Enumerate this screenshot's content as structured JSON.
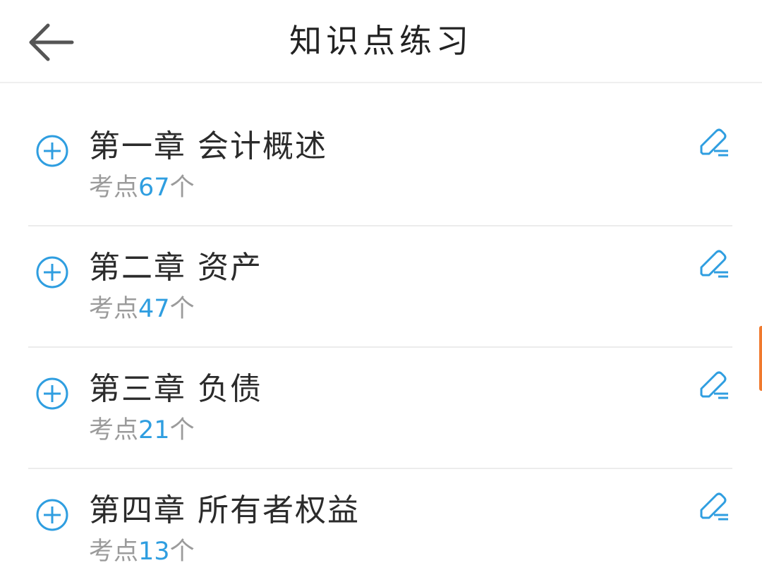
{
  "header": {
    "title": "知识点练习",
    "back_icon": "arrow-left-icon"
  },
  "chapters": [
    {
      "title": "第一章 会计概述",
      "points_prefix": "考点",
      "points_count": "67",
      "points_suffix": "个"
    },
    {
      "title": "第二章 资产",
      "points_prefix": "考点",
      "points_count": "47",
      "points_suffix": "个"
    },
    {
      "title": "第三章 负债",
      "points_prefix": "考点",
      "points_count": "21",
      "points_suffix": "个"
    },
    {
      "title": "第四章 所有者权益",
      "points_prefix": "考点",
      "points_count": "13",
      "points_suffix": "个"
    }
  ],
  "colors": {
    "accent": "#2f9ee0",
    "text": "#2b2b2b",
    "muted": "#9b9b9b",
    "side_tab": "#f07a2e"
  },
  "icons": {
    "expand": "plus-circle-icon",
    "practice": "edit-pencil-icon"
  }
}
